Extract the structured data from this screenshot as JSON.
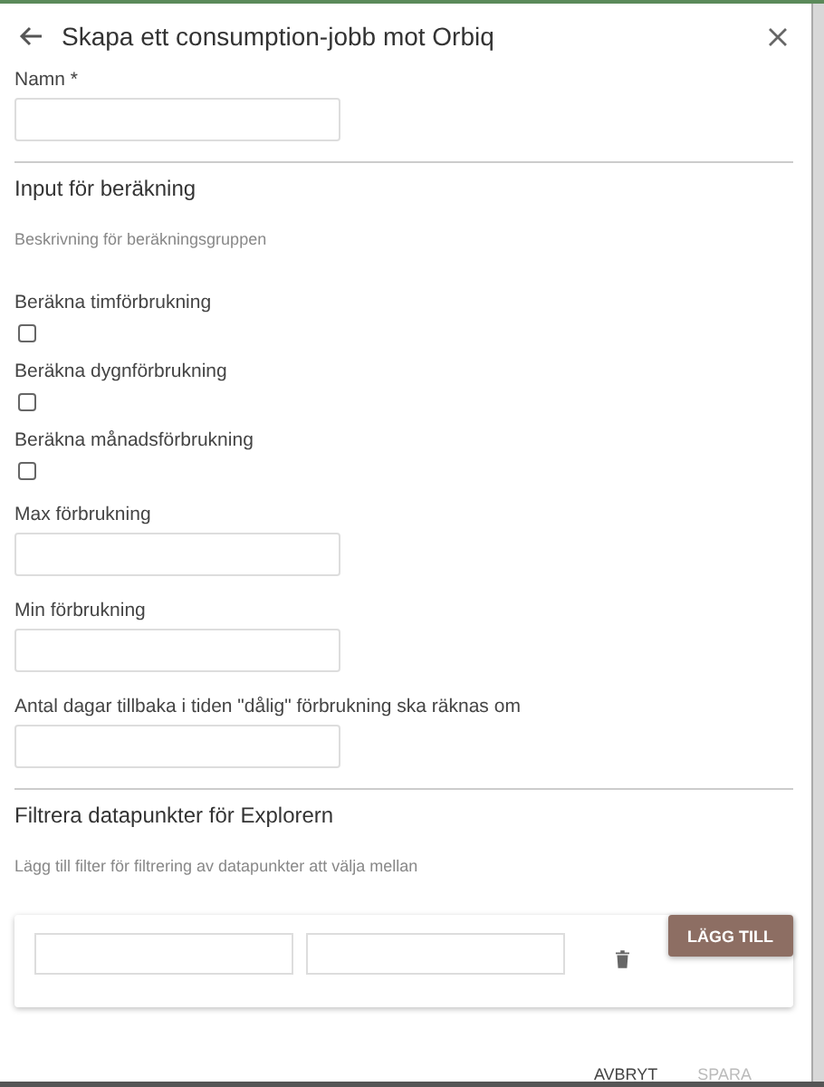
{
  "dialog": {
    "title": "Skapa ett consumption-jobb mot Orbiq"
  },
  "name_field": {
    "label": "Namn *"
  },
  "calc_section": {
    "heading": "Input för beräkning",
    "description": "Beskrivning för beräkningsgruppen",
    "items": [
      {
        "kind": "checkbox",
        "label": "Beräkna timförbrukning",
        "checked": false
      },
      {
        "kind": "checkbox",
        "label": "Beräkna dygnförbrukning",
        "checked": false
      },
      {
        "kind": "checkbox",
        "label": "Beräkna månadsförbrukning",
        "checked": false
      },
      {
        "kind": "field",
        "label": "Max förbrukning"
      },
      {
        "kind": "field",
        "label": "Min förbrukning"
      },
      {
        "kind": "field",
        "label": "Antal dagar tillbaka i tiden \"dålig\" förbrukning ska räknas om"
      }
    ]
  },
  "filter_section": {
    "heading": "Filtrera datapunkter för Explorern",
    "description": "Lägg till filter för filtrering av datapunkter att välja mellan",
    "add_button": "LÄGG TILL"
  },
  "footer": {
    "buttons": [
      {
        "label": "AVBRYT",
        "disabled": false
      },
      {
        "label": "SPARA",
        "disabled": true
      }
    ]
  }
}
